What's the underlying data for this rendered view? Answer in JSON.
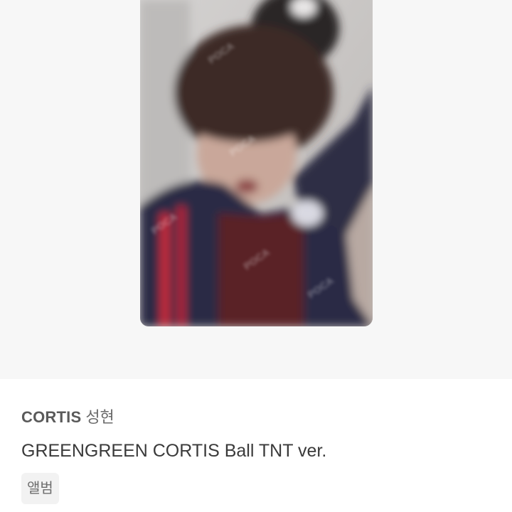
{
  "product": {
    "image": {
      "watermark": "POCA"
    },
    "artist": "CORTIS",
    "member": "성현",
    "title": "GREENGREEN CORTIS Ball TNT ver.",
    "tags": [
      "앨범"
    ]
  }
}
